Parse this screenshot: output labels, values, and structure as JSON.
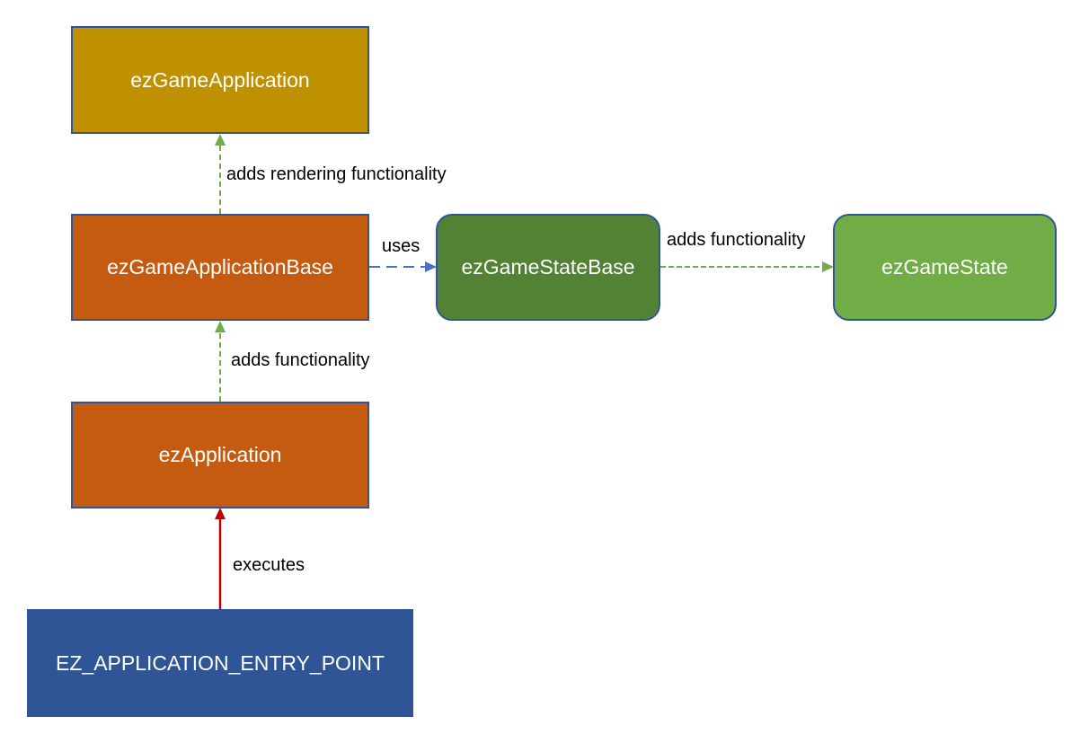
{
  "nodes": {
    "game_application": {
      "label": "ezGameApplication",
      "fill": "#bf9000"
    },
    "game_application_base": {
      "label": "ezGameApplicationBase",
      "fill": "#c55a11"
    },
    "application": {
      "label": "ezApplication",
      "fill": "#c55a11"
    },
    "entry_point": {
      "label": "EZ_APPLICATION_ENTRY_POINT",
      "fill": "#2f5597"
    },
    "game_state_base": {
      "label": "ezGameStateBase",
      "fill": "#548235"
    },
    "game_state": {
      "label": "ezGameState",
      "fill": "#70ad47"
    }
  },
  "edges": {
    "rendering": {
      "label": "adds rendering functionality",
      "from": "ezGameApplicationBase",
      "to": "ezGameApplication",
      "style": "dashed",
      "color": "#70ad47"
    },
    "functionality_app": {
      "label": "adds functionality",
      "from": "ezApplication",
      "to": "ezGameApplicationBase",
      "style": "dashed",
      "color": "#70ad47"
    },
    "executes": {
      "label": "executes",
      "from": "EZ_APPLICATION_ENTRY_POINT",
      "to": "ezApplication",
      "style": "solid",
      "color": "#c00000"
    },
    "uses": {
      "label": "uses",
      "from": "ezGameApplicationBase",
      "to": "ezGameStateBase",
      "style": "dashed",
      "color": "#4472c4"
    },
    "functionality_state": {
      "label": "adds functionality",
      "from": "ezGameStateBase",
      "to": "ezGameState",
      "style": "dashed",
      "color": "#70ad47"
    }
  }
}
